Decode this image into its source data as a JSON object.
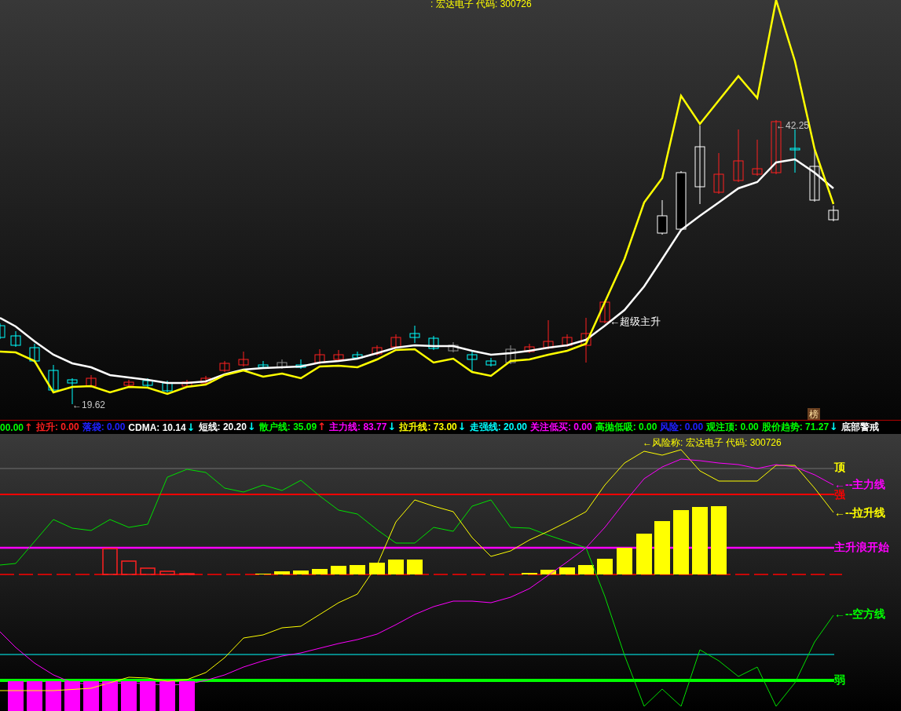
{
  "price_panel": {
    "title": ": 宏达电子 代码: 300726",
    "high_label": "←42.25",
    "low_label": "←19.62",
    "signal_label": "←超级主升",
    "badge": "榜"
  },
  "indicators": [
    {
      "text": "00.00",
      "arrow": {
        "text": "↑",
        "kind": "up"
      },
      "color": "#00ff00"
    },
    {
      "text": "拉升: 0.00",
      "color": "#ff2020"
    },
    {
      "text": "落袋: 0.00",
      "color": "#2020ff"
    },
    {
      "text": "CDMA: 10.14",
      "arrow": {
        "text": "↓",
        "kind": "down"
      },
      "color": "#ffffff"
    },
    {
      "text": "短线: 20.20",
      "arrow": {
        "text": "↓",
        "kind": "down"
      },
      "color": "#ffffff"
    },
    {
      "text": "散户线: 35.09",
      "arrow": {
        "text": "↑",
        "kind": "up"
      },
      "color": "#00ff00"
    },
    {
      "text": "主力线: 83.77",
      "arrow": {
        "text": "↓",
        "kind": "down"
      },
      "color": "#ff00ff"
    },
    {
      "text": "拉升线: 73.00",
      "arrow": {
        "text": "↓",
        "kind": "down"
      },
      "color": "#ffff00"
    },
    {
      "text": "走强线: 20.00",
      "color": "#00ffff"
    },
    {
      "text": "关注低买: 0.00",
      "color": "#ff00ff"
    },
    {
      "text": "高抛低吸: 0.00",
      "color": "#00ff00"
    },
    {
      "text": "风险: 0.00",
      "color": "#2020ff"
    },
    {
      "text": "观注顶: 0.00",
      "color": "#00ff00"
    },
    {
      "text": "股价趋势: 71.27",
      "arrow": {
        "text": "↓",
        "kind": "down"
      },
      "color": "#00ff00"
    },
    {
      "text": "底部警戒",
      "color": "#ffffff"
    }
  ],
  "indicator_panel": {
    "title": "←风险称: 宏达电子 代码: 300726",
    "labels": [
      {
        "text": "顶",
        "color": "#ffff00"
      },
      {
        "text": "←--主力线",
        "color": "#ff00ff"
      },
      {
        "text": "强",
        "color": "#ff0000"
      },
      {
        "text": "←--拉升线",
        "color": "#ffff00"
      },
      {
        "text": "主升浪开始",
        "color": "#ff00ff"
      },
      {
        "text": "←--空方线",
        "color": "#00ff00"
      },
      {
        "text": "弱",
        "color": "#00ff00"
      }
    ]
  }
}
